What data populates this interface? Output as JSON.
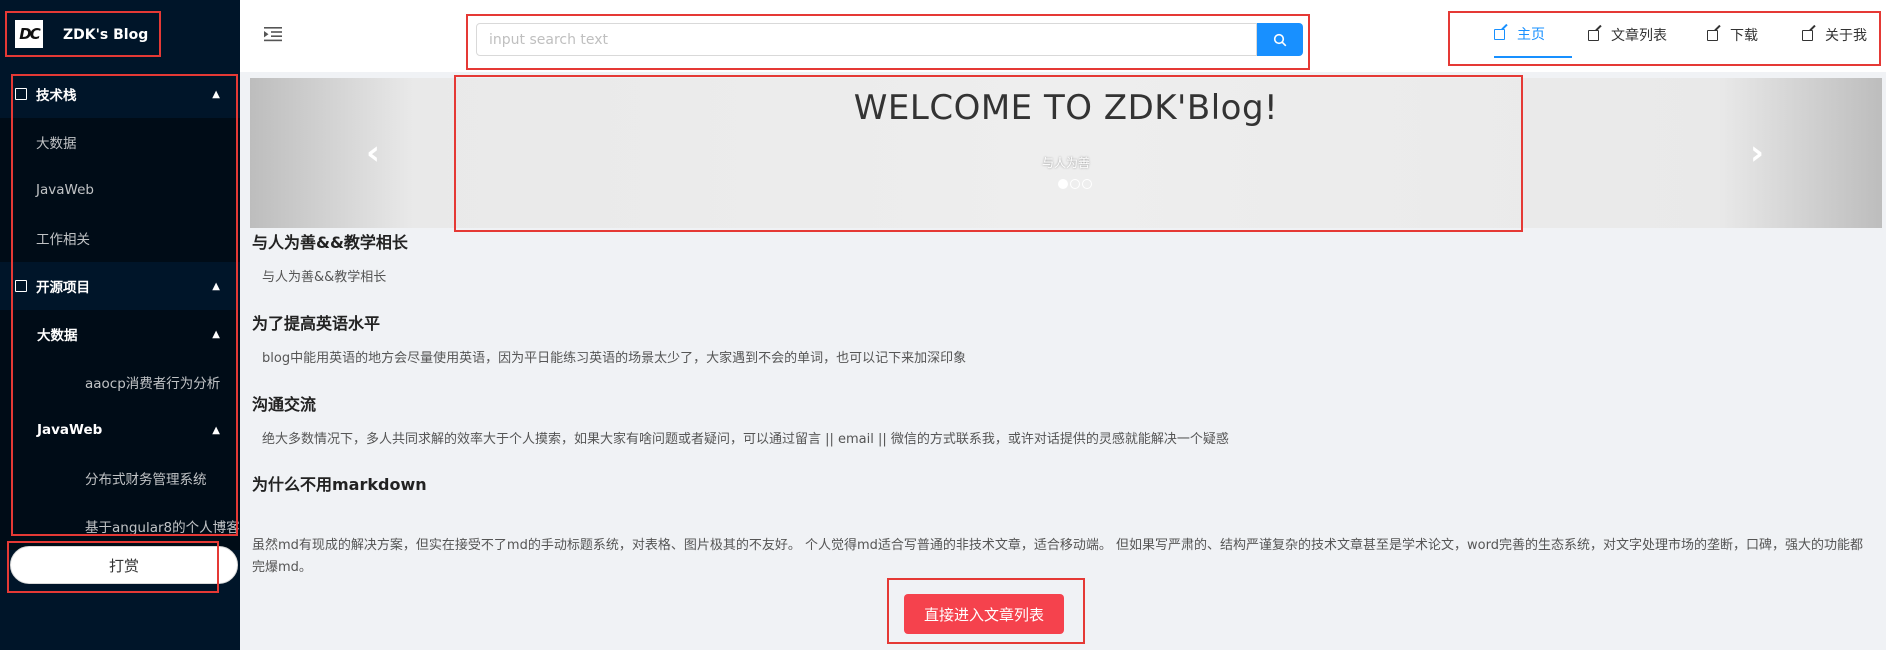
{
  "sidebar": {
    "logo_text": "DC",
    "title": "ZDK's Blog",
    "menu": [
      {
        "label": "技术栈",
        "type": "group",
        "expanded": true
      },
      {
        "label": "大数据",
        "type": "item",
        "level": 1
      },
      {
        "label": "JavaWeb",
        "type": "item",
        "level": 1
      },
      {
        "label": "工作相关",
        "type": "item",
        "level": 1
      },
      {
        "label": "开源项目",
        "type": "group",
        "expanded": true
      },
      {
        "label": "大数据",
        "type": "subgroup",
        "expanded": true
      },
      {
        "label": "aaocp消费者行为分析",
        "type": "item",
        "level": 2
      },
      {
        "label": "JavaWeb",
        "type": "subgroup",
        "expanded": true
      },
      {
        "label": "分布式财务管理系统",
        "type": "item",
        "level": 2
      },
      {
        "label": "基于angular8的个人博客",
        "type": "item",
        "level": 2
      }
    ],
    "donate_label": "打赏"
  },
  "header": {
    "search": {
      "placeholder": "input search text",
      "value": ""
    },
    "nav": [
      {
        "label": "主页",
        "active": true
      },
      {
        "label": "文章列表",
        "active": false
      },
      {
        "label": "下载",
        "active": false
      },
      {
        "label": "关于我",
        "active": false
      }
    ]
  },
  "carousel": {
    "title": "WELCOME TO ZDK'Blog!",
    "caption": "与人为善",
    "slide_count": 3,
    "active_slide": 1
  },
  "sections": [
    {
      "title": "与人为善&&教学相长",
      "text": "与人为善&&教学相长"
    },
    {
      "title": "为了提高英语水平",
      "text": "blog中能用英语的地方会尽量使用英语，因为平日能练习英语的场景太少了，大家遇到不会的单词，也可以记下来加深印象"
    },
    {
      "title": "沟通交流",
      "text": "绝大多数情况下，多人共同求解的效率大于个人摸索，如果大家有啥问题或者疑问，可以通过留言 || email || 微信的方式联系我，或许对话提供的灵感就能解决一个疑惑"
    },
    {
      "title": "为什么不用markdown",
      "text": "虽然md有现成的解决方案，但实在接受不了md的手动标题系统，对表格、图片极其的不友好。 个人觉得md适合写普通的非技术文章，适合移动端。 但如果写严肃的、结构严谨复杂的技术文章甚至是学术论文，word完善的生态系统，对文字处理市场的垄断，口碑，强大的功能都完爆md。"
    }
  ],
  "enter_button_label": "直接进入文章列表",
  "colors": {
    "sidebar_bg": "#001529",
    "accent": "#1890ff",
    "cta": "#f5424d",
    "highlight_box": "#e53935"
  }
}
